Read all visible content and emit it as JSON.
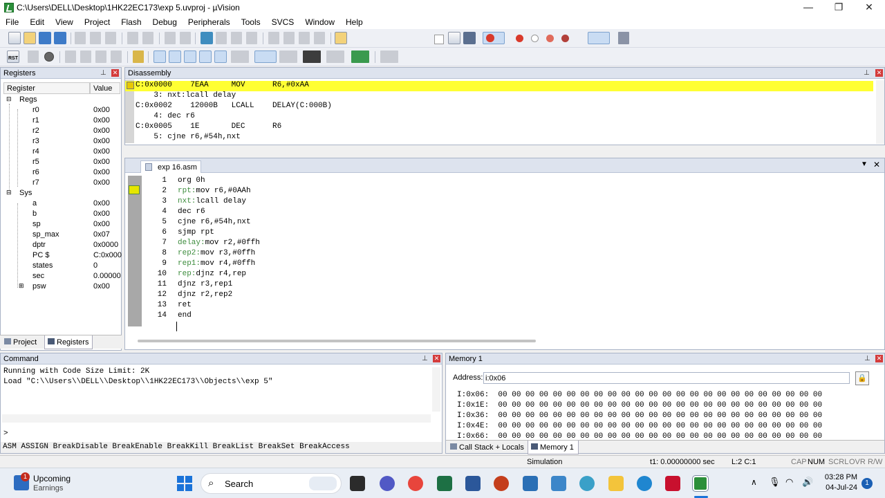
{
  "window": {
    "title": "C:\\Users\\DELL\\Desktop\\1HK22EC173\\exp 5.uvproj - µVision",
    "min": "—",
    "max": "❐",
    "close": "✕"
  },
  "menu": [
    "File",
    "Edit",
    "View",
    "Project",
    "Flash",
    "Debug",
    "Peripherals",
    "Tools",
    "SVCS",
    "Window",
    "Help"
  ],
  "toolbar2": {
    "rst": "RST"
  },
  "registers": {
    "title": "Registers",
    "col_register": "Register",
    "col_value": "Value",
    "regs_group": "Regs",
    "sys_group": "Sys",
    "regs": [
      {
        "name": "r0",
        "value": "0x00"
      },
      {
        "name": "r1",
        "value": "0x00"
      },
      {
        "name": "r2",
        "value": "0x00"
      },
      {
        "name": "r3",
        "value": "0x00"
      },
      {
        "name": "r4",
        "value": "0x00"
      },
      {
        "name": "r5",
        "value": "0x00"
      },
      {
        "name": "r6",
        "value": "0x00"
      },
      {
        "name": "r7",
        "value": "0x00"
      }
    ],
    "sys": [
      {
        "name": "a",
        "value": "0x00"
      },
      {
        "name": "b",
        "value": "0x00"
      },
      {
        "name": "sp",
        "value": "0x00"
      },
      {
        "name": "sp_max",
        "value": "0x07"
      },
      {
        "name": "dptr",
        "value": "0x0000"
      },
      {
        "name": "PC  $",
        "value": "C:0x000"
      },
      {
        "name": "states",
        "value": "0"
      },
      {
        "name": "sec",
        "value": "0.00000"
      },
      {
        "name": "psw",
        "value": "0x00"
      }
    ],
    "tab_project": "Project",
    "tab_registers": "Registers"
  },
  "disassembly": {
    "title": "Disassembly",
    "lines": [
      "C:0x0000    7EAA     MOV      R6,#0xAA",
      "    3: nxt:lcall delay",
      "C:0x0002    12000B   LCALL    DELAY(C:000B)",
      "    4: dec r6",
      "C:0x0005    1E       DEC      R6",
      "    5: cjne r6,#54h,nxt"
    ]
  },
  "editor": {
    "tab": "exp 16.asm",
    "line_numbers": [
      "1",
      "2",
      "3",
      "4",
      "5",
      "6",
      "7",
      "8",
      "9",
      "10",
      "11",
      "12",
      "13",
      "14"
    ],
    "lines": [
      {
        "label": "",
        "code": "org 0h"
      },
      {
        "label": "rpt:",
        "code": "mov r6,#0AAh"
      },
      {
        "label": "nxt:",
        "code": "lcall delay"
      },
      {
        "label": "",
        "code": "dec r6"
      },
      {
        "label": "",
        "code": "cjne r6,#54h,nxt"
      },
      {
        "label": "",
        "code": "sjmp rpt"
      },
      {
        "label": "delay:",
        "code": "mov r2,#0ffh"
      },
      {
        "label": "rep2:",
        "code": "mov r3,#0ffh"
      },
      {
        "label": "rep1:",
        "code": "mov r4,#0ffh"
      },
      {
        "label": "rep:",
        "code": "djnz r4,rep"
      },
      {
        "label": "",
        "code": "djnz r3,rep1"
      },
      {
        "label": "",
        "code": "djnz r2,rep2"
      },
      {
        "label": "",
        "code": "ret"
      },
      {
        "label": "",
        "code": "end"
      }
    ]
  },
  "command": {
    "title": "Command",
    "lines": [
      "Running with Code Size Limit: 2K",
      "Load \"C:\\\\Users\\\\DELL\\\\Desktop\\\\1HK22EC173\\\\Objects\\\\exp 5\""
    ],
    "prompt": ">",
    "hint": "ASM ASSIGN BreakDisable BreakEnable BreakKill BreakList BreakSet BreakAccess"
  },
  "memory": {
    "title": "Memory 1",
    "address_label": "Address:",
    "address_value": "i:0x06",
    "rows": [
      {
        "addr": "I:0x06:",
        "bytes": "00 00 00 00 00 00 00 00 00 00 00 00 00 00 00 00 00 00 00 00 00 00 00 00"
      },
      {
        "addr": "I:0x1E:",
        "bytes": "00 00 00 00 00 00 00 00 00 00 00 00 00 00 00 00 00 00 00 00 00 00 00 00"
      },
      {
        "addr": "I:0x36:",
        "bytes": "00 00 00 00 00 00 00 00 00 00 00 00 00 00 00 00 00 00 00 00 00 00 00 00"
      },
      {
        "addr": "I:0x4E:",
        "bytes": "00 00 00 00 00 00 00 00 00 00 00 00 00 00 00 00 00 00 00 00 00 00 00 00"
      },
      {
        "addr": "I:0x66:",
        "bytes": "00 00 00 00 00 00 00 00 00 00 00 00 00 00 00 00 00 00 00 00 00 00 00 00"
      }
    ],
    "tab_callstack": "Call Stack + Locals",
    "tab_memory": "Memory 1"
  },
  "status": {
    "mode": "Simulation",
    "time": "t1: 0.00000000 sec",
    "pos": "L:2 C:1",
    "caps": "CAP",
    "num": "NUM",
    "scrl": "SCRL",
    "ovr": "OVR",
    "rw": "R/W"
  },
  "taskbar": {
    "weather_title": "Upcoming",
    "weather_sub": "Earnings",
    "weather_badge": "1",
    "search": "Search",
    "time": "03:28 PM",
    "date": "04-Jul-24",
    "notif": "1"
  }
}
